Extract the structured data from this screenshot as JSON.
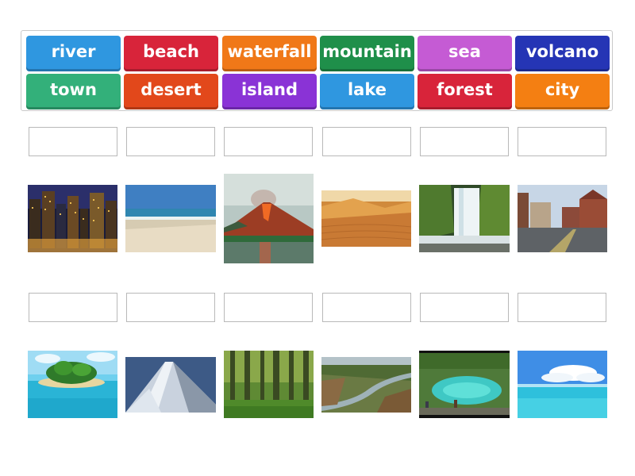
{
  "word_bank": {
    "tiles": [
      {
        "label": "river",
        "color": "#2f97e0"
      },
      {
        "label": "beach",
        "color": "#d8243a"
      },
      {
        "label": "waterfall",
        "color": "#f07818"
      },
      {
        "label": "mountain",
        "color": "#1f8f4a"
      },
      {
        "label": "sea",
        "color": "#c55bd4"
      },
      {
        "label": "volcano",
        "color": "#2535b5"
      },
      {
        "label": "town",
        "color": "#33b07a"
      },
      {
        "label": "desert",
        "color": "#e2481b"
      },
      {
        "label": "island",
        "color": "#8a33d6"
      },
      {
        "label": "lake",
        "color": "#2f97e0"
      },
      {
        "label": "forest",
        "color": "#d8243a"
      },
      {
        "label": "city",
        "color": "#f47f12"
      }
    ]
  },
  "drop_slots_row1": [
    "",
    "",
    "",
    "",
    "",
    ""
  ],
  "drop_slots_row2": [
    "",
    "",
    "",
    "",
    "",
    ""
  ],
  "pictures_row1": [
    "city-night-photo",
    "beach-photo",
    "volcano-photo",
    "desert-photo",
    "waterfall-photo",
    "town-street-photo"
  ],
  "pictures_row2": [
    "island-photo",
    "mountain-photo",
    "forest-photo",
    "river-photo",
    "lake-photo",
    "sea-photo"
  ]
}
